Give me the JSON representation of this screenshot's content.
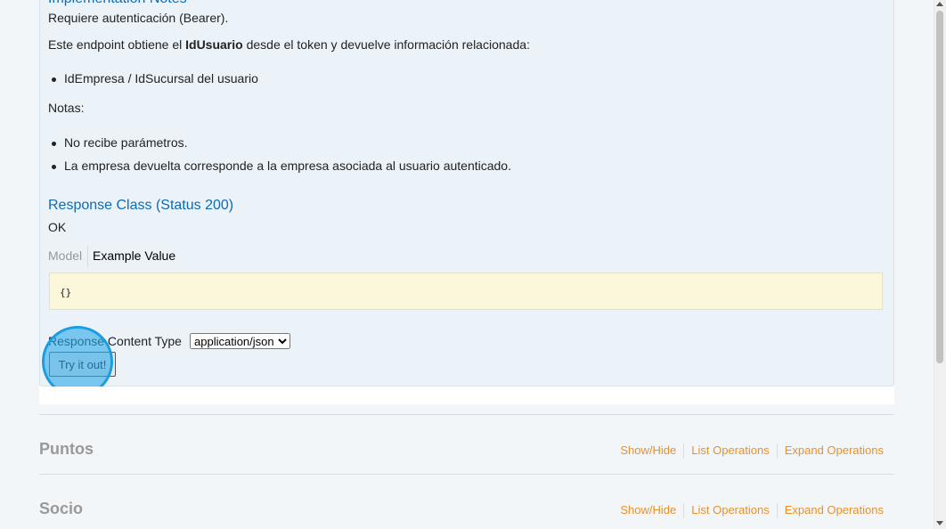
{
  "implementation": {
    "title": "Implementation Notes",
    "auth": "Requiere autenticación (Bearer).",
    "desc_before": "Este endpoint obtiene el ",
    "desc_bold": "IdUsuario",
    "desc_after": " desde el token y devuelve información relacionada:",
    "bullets1": [
      "IdEmpresa / IdSucursal del usuario"
    ],
    "notes_label": "Notas:",
    "bullets2": [
      "No recibe parámetros.",
      "La empresa devuelta corresponde a la empresa asociada al usuario autenticado."
    ]
  },
  "response": {
    "title": "Response Class (Status 200)",
    "status_text": "OK",
    "tab_model": "Model",
    "tab_example": "Example Value",
    "example_code": "{}",
    "content_type_label": "Response Content Type",
    "content_type_value": "application/json",
    "try_button": "Try it out!"
  },
  "sections": [
    {
      "title": "Puntos",
      "show_hide": "Show/Hide",
      "list_ops": "List Operations",
      "expand_ops": "Expand Operations"
    },
    {
      "title": "Socio",
      "show_hide": "Show/Hide",
      "list_ops": "List Operations",
      "expand_ops": "Expand Operations"
    }
  ],
  "colors": {
    "link_blue": "#0f6ab4",
    "link_orange": "#e8912a",
    "click_highlight": "#2caaeb"
  }
}
